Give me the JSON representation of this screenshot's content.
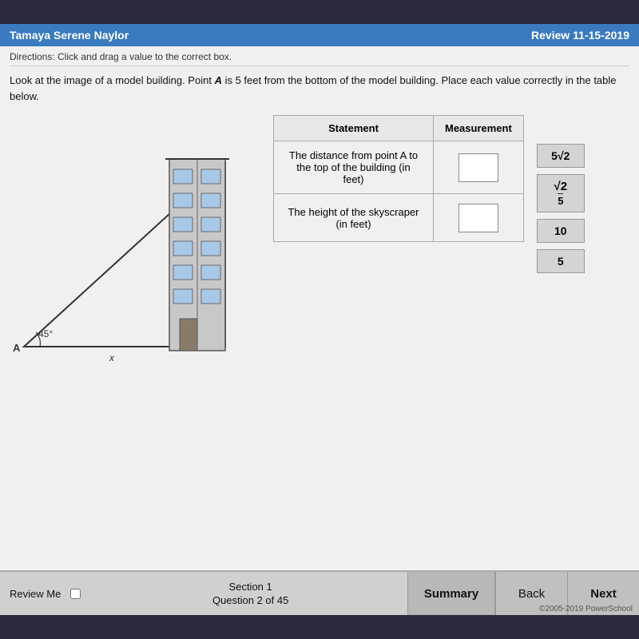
{
  "header": {
    "student_name": "Tamaya Serene Naylor",
    "review_date": "Review 11-15-2019"
  },
  "directions": "Directions: Click and drag a value to the correct box.",
  "problem": {
    "text_part1": "Look at the image of a model building.  Point ",
    "point": "A",
    "text_part2": " is 5 feet from the bottom of the model building.  Place each value correctly in the table below."
  },
  "building": {
    "angle_label": "45°",
    "x_label": "x",
    "point_label": "A"
  },
  "table": {
    "col1_header": "Statement",
    "col2_header": "Measurement",
    "rows": [
      {
        "statement": "The distance from point A  to the top of the building (in feet)"
      },
      {
        "statement": "The height of the skyscraper (in feet)"
      }
    ]
  },
  "answer_options": [
    {
      "id": "opt1",
      "display": "5√2",
      "type": "sqrt",
      "value": "5√2"
    },
    {
      "id": "opt2",
      "display": "√2/5",
      "type": "fraction_sqrt",
      "value": "√2/5"
    },
    {
      "id": "opt3",
      "display": "10",
      "type": "plain",
      "value": "10"
    },
    {
      "id": "opt4",
      "display": "5",
      "type": "plain",
      "value": "5"
    }
  ],
  "footer": {
    "review_me_label": "Review Me",
    "section_label": "Section 1",
    "question_label": "Question 2 of 45",
    "summary_label": "Summary",
    "back_label": "Back",
    "next_label": "Next",
    "copyright": "©2005-2019 PowerSchool"
  }
}
